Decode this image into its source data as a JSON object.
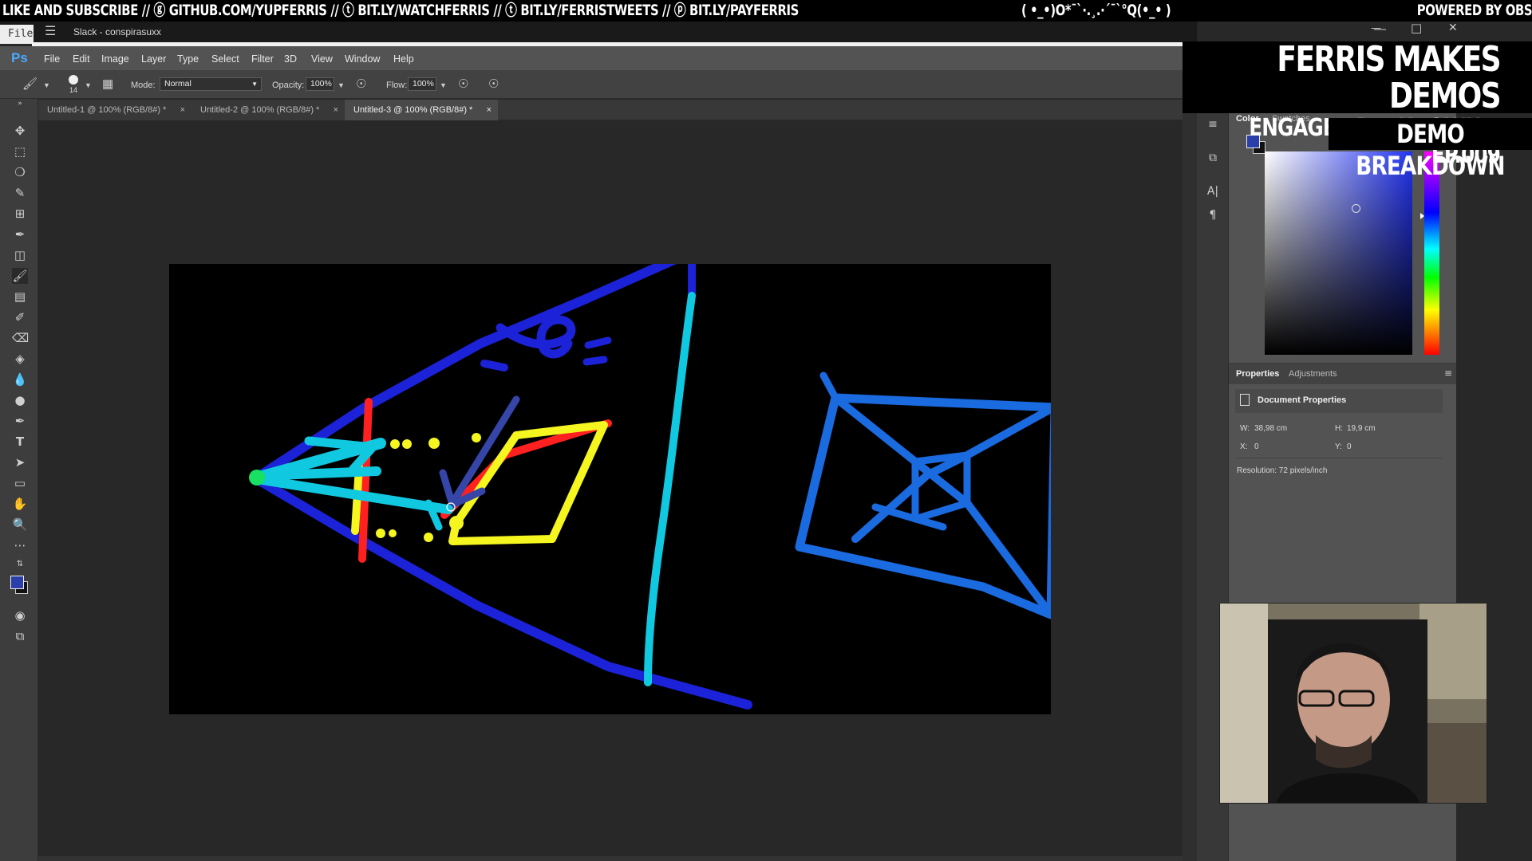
{
  "banner": {
    "left": "LIKE AND SUBSCRIBE // ⓖ GITHUB.COM/YUPFERRIS // ⓣ BIT.LY/WATCHFERRIS // ⓣ BIT.LY/FERRISTWEETS // ⓟ BIT.LY/PAYFERRIS",
    "center": "( •_•)O*¯`·.¸.·´¯`°Q(•_• )",
    "right": "POWERED BY OBS"
  },
  "window": {
    "file_tab": "File",
    "title": "Slack - conspirasuxx",
    "minimize": "—",
    "maximize": "□",
    "close": "✕"
  },
  "menubar": {
    "logo": "Ps",
    "items": [
      "File",
      "Edit",
      "Image",
      "Layer",
      "Type",
      "Select",
      "Filter",
      "3D",
      "View",
      "Window",
      "Help"
    ]
  },
  "options": {
    "brush_size": "14",
    "mode_label": "Mode:",
    "mode_value": "Normal",
    "opacity_label": "Opacity:",
    "opacity_value": "100%",
    "flow_label": "Flow:",
    "flow_value": "100%"
  },
  "tabs": [
    {
      "label": "Untitled-1 @ 100% (RGB/8#) *",
      "active": false
    },
    {
      "label": "Untitled-2 @ 100% (RGB/8#) *",
      "active": false
    },
    {
      "label": "Untitled-3 @ 100% (RGB/8#) *",
      "active": true
    }
  ],
  "tab_close": "×",
  "color_panel": {
    "tabs": [
      "Color",
      "Swatches"
    ],
    "foreground": "#2a3faa",
    "background": "#111111"
  },
  "properties": {
    "tabs": [
      "Properties",
      "Adjustments"
    ],
    "header": "Document Properties",
    "w_label": "W:",
    "w_value": "38,98 cm",
    "h_label": "H:",
    "h_value": "19,9 cm",
    "x_label": "X:",
    "x_value": "0",
    "y_label": "Y:",
    "y_value": "0",
    "resolution": "Resolution: 72 pixels/inch"
  },
  "overlay": {
    "title_line1": "FERRIS MAKES DEMOS",
    "title_line2": "ENGAGE BREAKDOWN // EP.009",
    "tag": "DEMO BREAKDOWN"
  }
}
